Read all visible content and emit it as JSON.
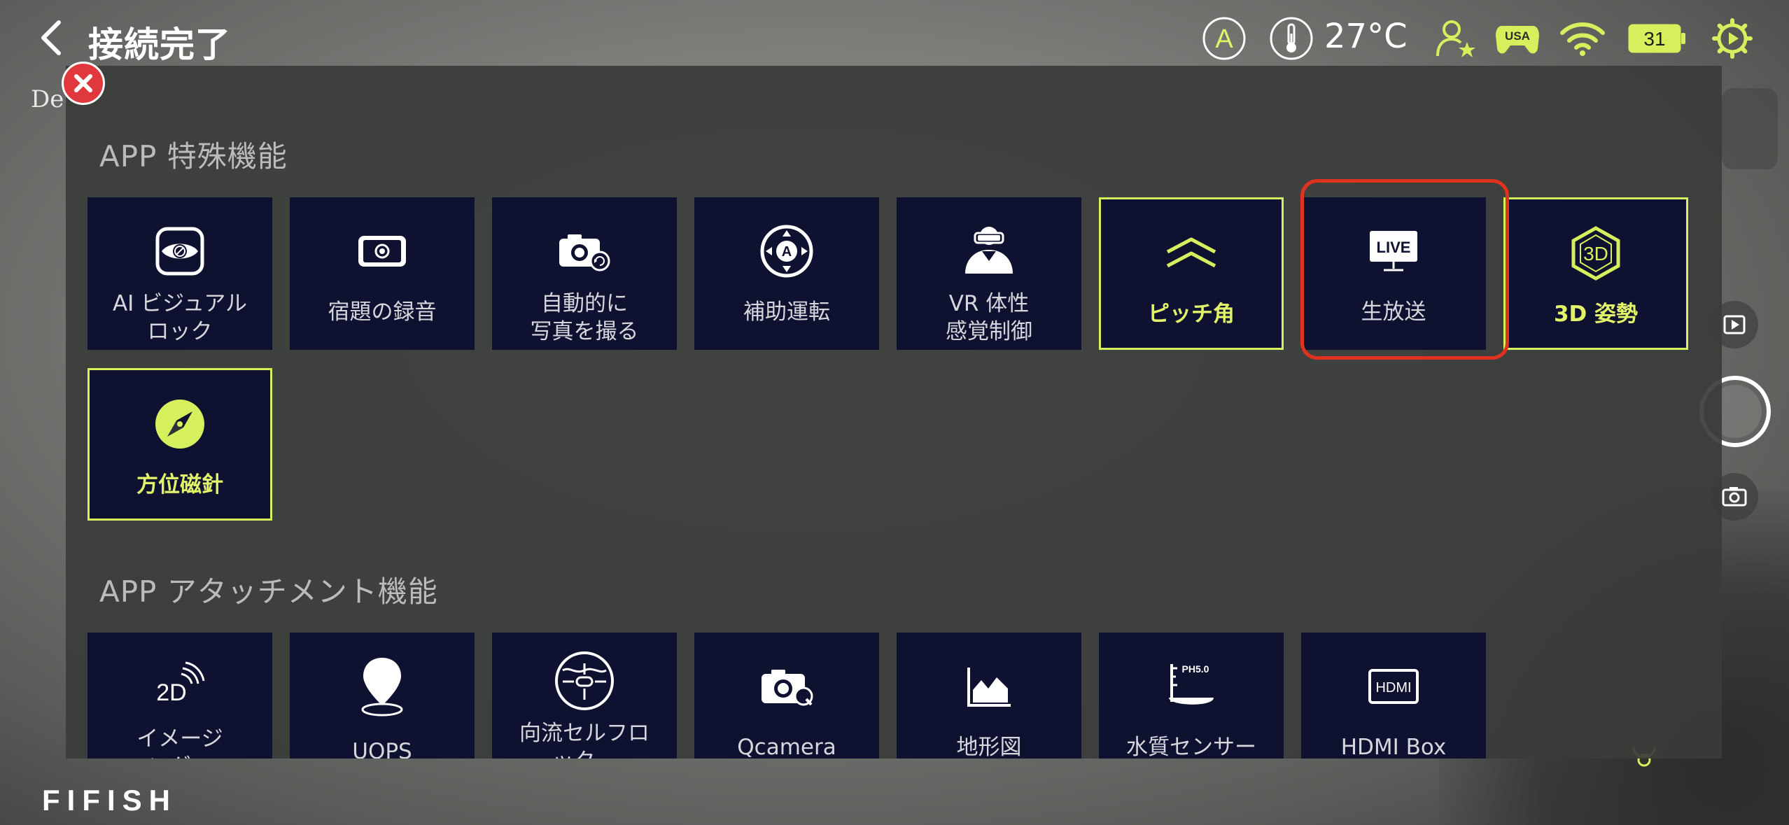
{
  "header": {
    "title": "接続完了",
    "auto_mode_label": "A",
    "temperature": "27°C",
    "region_badge": "USA",
    "battery_level": "31"
  },
  "background": {
    "partial_text": "De"
  },
  "sections": [
    {
      "title": "APP 特殊機能",
      "items": [
        {
          "label": "AI ビジュアル\nロック",
          "icon": "ai-visual-lock-icon",
          "highlighted": false
        },
        {
          "label": "宿題の録音",
          "icon": "phone-record-icon",
          "highlighted": false
        },
        {
          "label": "自動的に\n写真を撮る",
          "icon": "auto-camera-icon",
          "highlighted": false
        },
        {
          "label": "補助運転",
          "icon": "assist-drive-icon",
          "highlighted": false
        },
        {
          "label": "VR 体性\n感覚制御",
          "icon": "vr-headset-icon",
          "highlighted": false
        },
        {
          "label": "ピッチ角",
          "icon": "pitch-chevron-icon",
          "highlighted": true
        },
        {
          "label": "生放送",
          "icon": "live-tv-icon",
          "highlighted": false
        },
        {
          "label": "3D 姿勢",
          "icon": "3d-cube-icon",
          "highlighted": true
        },
        {
          "label": "方位磁針",
          "icon": "compass-icon",
          "highlighted": true
        }
      ]
    },
    {
      "title": "APP アタッチメント機能",
      "items": [
        {
          "label": "イメージ\nング…",
          "icon": "2d-sonar-icon",
          "highlighted": false
        },
        {
          "label": "UQPS",
          "icon": "location-pin-icon",
          "highlighted": false
        },
        {
          "label": "向流セルフロ\nック…",
          "icon": "current-lock-icon",
          "highlighted": false
        },
        {
          "label": "Qcamera",
          "icon": "qcamera-icon",
          "highlighted": false
        },
        {
          "label": "地形図",
          "icon": "terrain-chart-icon",
          "highlighted": false
        },
        {
          "label": "水質センサー",
          "icon": "ph-sensor-icon",
          "highlighted": false
        },
        {
          "label": "HDMI Box",
          "icon": "hdmi-box-icon",
          "highlighted": false
        }
      ]
    }
  ],
  "icon_texts": {
    "live": "LIVE",
    "three_d": "3D",
    "two_d": "2D",
    "ph": "PH5.0",
    "hdmi": "HDMI",
    "assist_a": "A"
  },
  "brand": {
    "logo_text": "FIFISH"
  },
  "colors": {
    "accent": "#d6ef5c",
    "tile_bg": "#0f1131",
    "selection_outline": "#e0321e",
    "close_red": "#e0383c"
  }
}
